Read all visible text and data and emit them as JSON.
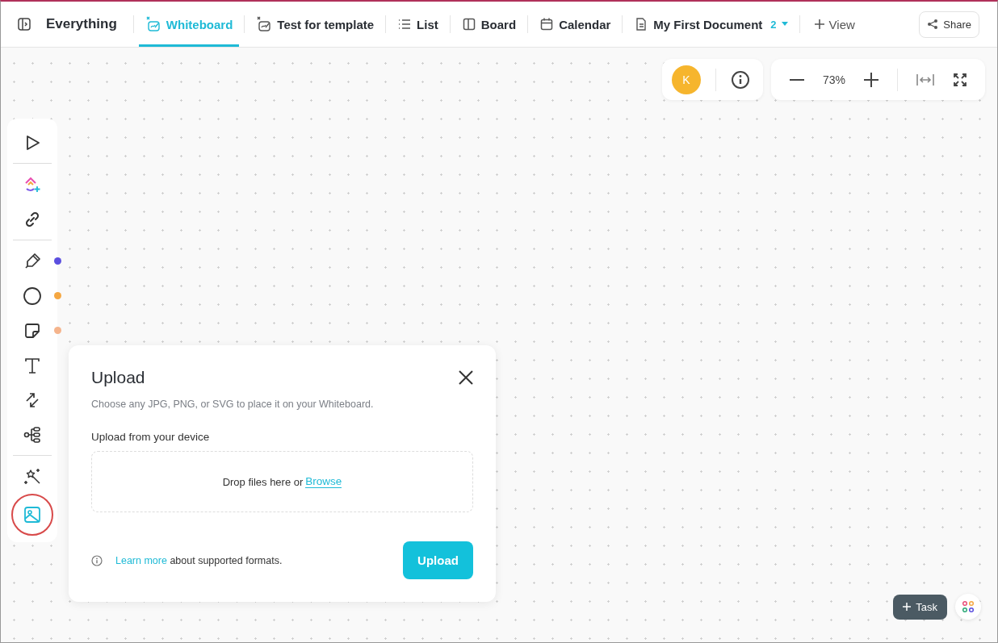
{
  "header": {
    "title": "Everything",
    "tabs": [
      {
        "label": "Whiteboard",
        "selected": true
      },
      {
        "label": "Test for template",
        "selected": false
      },
      {
        "label": "List",
        "selected": false
      },
      {
        "label": "Board",
        "selected": false
      },
      {
        "label": "Calendar",
        "selected": false
      },
      {
        "label": "My First Document",
        "selected": false,
        "count": "2"
      }
    ],
    "add_view": "View",
    "share": "Share"
  },
  "canvas_controls": {
    "avatar": "K",
    "zoom": "73%"
  },
  "toolbar": {
    "groups": [
      [
        {
          "selected": false
        }
      ],
      [
        {
          "selected": false
        },
        {
          "selected": false
        }
      ],
      [
        {
          "selected": false,
          "color": "#5b4fdf"
        },
        {
          "selected": false,
          "color": "#f5a742"
        },
        {
          "selected": false,
          "color": "#f5b48c"
        },
        {
          "selected": false
        },
        {
          "selected": false
        },
        {
          "selected": false
        }
      ],
      [
        {
          "selected": false
        },
        {
          "selected": true
        }
      ]
    ]
  },
  "upload_dialog": {
    "title": "Upload",
    "description": "Choose any JPG, PNG, or SVG to place it on your Whiteboard.",
    "section_label": "Upload from your device",
    "drop_text": "Drop files here or",
    "browse": "Browse",
    "learn_more": "Learn more",
    "footer_text": "about supported formats.",
    "button": "Upload"
  },
  "task_button": "Task"
}
